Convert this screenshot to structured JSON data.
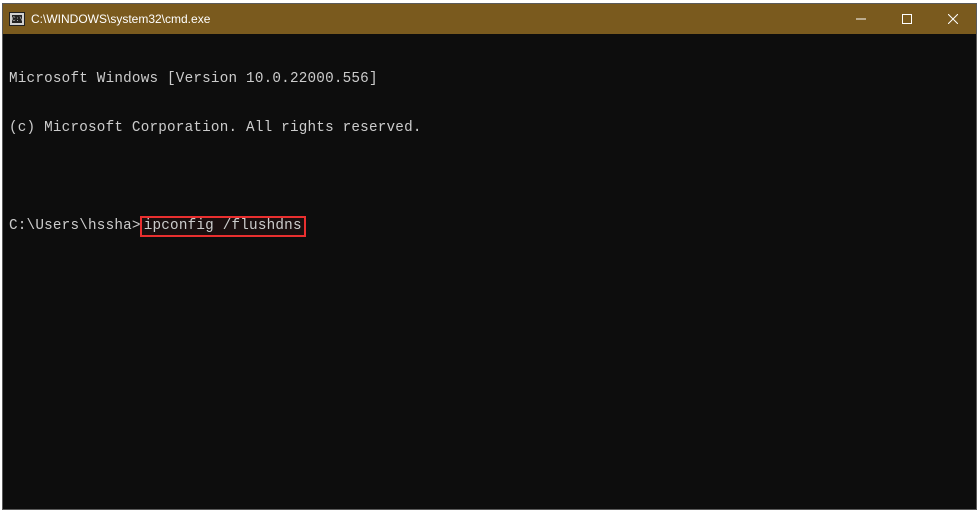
{
  "window": {
    "title": "C:\\WINDOWS\\system32\\cmd.exe"
  },
  "terminal": {
    "line1": "Microsoft Windows [Version 10.0.22000.556]",
    "line2": "(c) Microsoft Corporation. All rights reserved.",
    "prompt": "C:\\Users\\hssha>",
    "command": "ipconfig /flushdns"
  }
}
